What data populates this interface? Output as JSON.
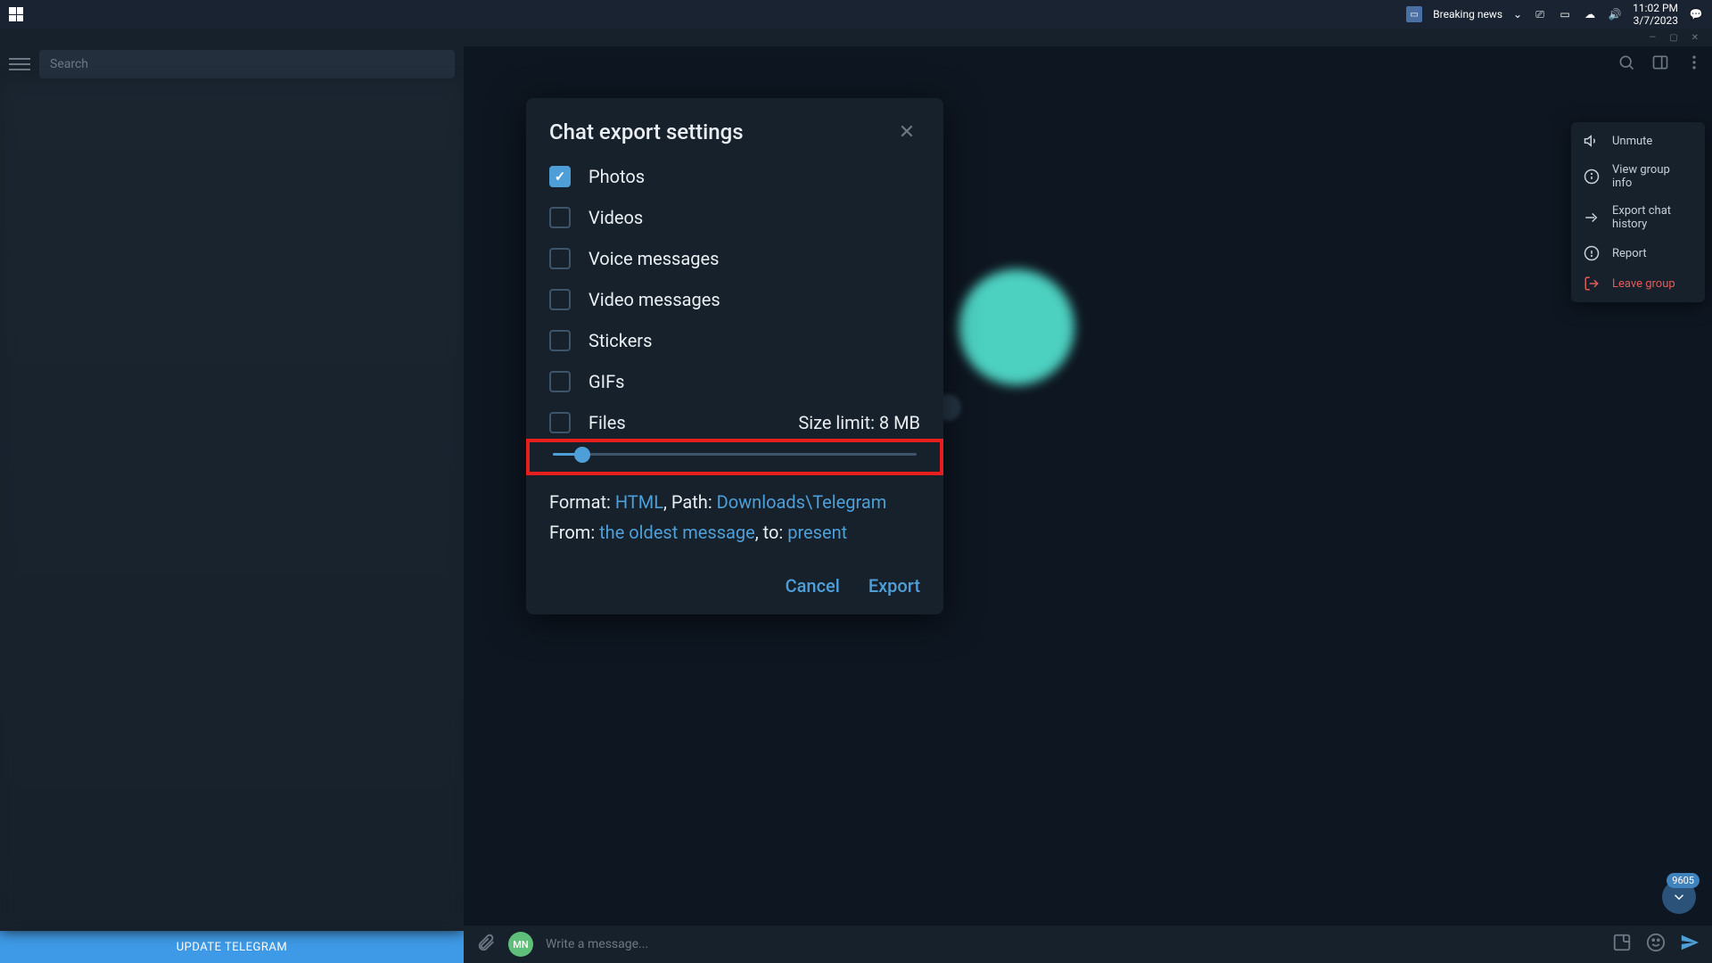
{
  "taskbar": {
    "news_label": "Breaking news",
    "time": "11:02 PM",
    "date": "3/7/2023"
  },
  "sidebar": {
    "search_placeholder": "Search",
    "update_label": "UPDATE TELEGRAM"
  },
  "context_menu": {
    "unmute": "Unmute",
    "view_info": "View group info",
    "export": "Export chat history",
    "report": "Report",
    "leave": "Leave group"
  },
  "dialog": {
    "title": "Chat export settings",
    "options": {
      "photos": "Photos",
      "videos": "Videos",
      "voice": "Voice messages",
      "video_msg": "Video messages",
      "stickers": "Stickers",
      "gifs": "GIFs",
      "files": "Files"
    },
    "size_limit_label": "Size limit: 8 MB",
    "slider_percent": 8,
    "format_prefix": "Format: ",
    "format_value": "HTML",
    "path_prefix": ", Path: ",
    "path_value": "Downloads\\Telegram",
    "from_prefix": "From: ",
    "from_value": "the oldest message",
    "to_prefix": ", to: ",
    "to_value": "present",
    "cancel": "Cancel",
    "export": "Export"
  },
  "scroll_count": "9605",
  "message_bar": {
    "avatar": "MN",
    "placeholder": "Write a message..."
  }
}
